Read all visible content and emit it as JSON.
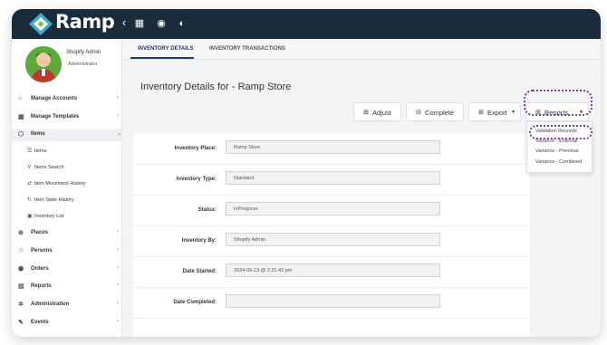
{
  "app": {
    "logo_text": "Ramp"
  },
  "topbar": {
    "icons": [
      "collapse-arrow-icon",
      "grid-icon",
      "globe-icon",
      "dashboard-gauge-icon"
    ],
    "collapse_glyph": "‹",
    "grid_glyph": "▦",
    "globe_glyph": "◉",
    "gauge_glyph": "◐"
  },
  "user": {
    "name": "Shopify Admin",
    "role": "Administrator"
  },
  "sidebar": {
    "items": [
      {
        "label": "Manage Accounts",
        "icon": "building-icon",
        "glyph": "⌂"
      },
      {
        "label": "Manage Templates",
        "icon": "grid-icon",
        "glyph": "▦"
      },
      {
        "label": "Items",
        "icon": "tag-icon",
        "glyph": "⬡"
      },
      {
        "label": "Places",
        "icon": "location-icon",
        "glyph": "⊕"
      },
      {
        "label": "Persons",
        "icon": "person-icon",
        "glyph": "☺"
      },
      {
        "label": "Orders",
        "icon": "box-icon",
        "glyph": "⬢"
      },
      {
        "label": "Reports",
        "icon": "report-icon",
        "glyph": "▤"
      },
      {
        "label": "Administration",
        "icon": "gear-icon",
        "glyph": "✲"
      },
      {
        "label": "Events",
        "icon": "events-icon",
        "glyph": "✎"
      }
    ],
    "sub_items": [
      {
        "label": "Items",
        "glyph": "☰"
      },
      {
        "label": "Items Search",
        "glyph": "⚲"
      },
      {
        "label": "Item Movement History",
        "glyph": "⇄"
      },
      {
        "label": "Item State History",
        "glyph": "↻"
      },
      {
        "label": "Inventory List",
        "glyph": "▣"
      }
    ],
    "chevron": "›",
    "chevron_open": "⌄"
  },
  "tabs": [
    {
      "label": "INVENTORY DETAILS"
    },
    {
      "label": "INVENTORY TRANSACTIONS"
    }
  ],
  "page": {
    "title": "Inventory Details for - Ramp Store"
  },
  "toolbar": {
    "adjust_label": "Adjust",
    "complete_label": "Complete",
    "export_label": "Export",
    "reports_label": "Reports",
    "dropdown_caret": "▼"
  },
  "form": {
    "rows": [
      {
        "label": "Inventory Place:",
        "value": "Ramp Store"
      },
      {
        "label": "Inventory Type:",
        "value": "Standard"
      },
      {
        "label": "Status:",
        "value": "InProgress"
      },
      {
        "label": "Inventory By:",
        "value": "Shopify Admin"
      },
      {
        "label": "Date Started:",
        "value": "2024-09-13 @ 2:21:43 pm"
      },
      {
        "label": "Date Completed:",
        "value": ""
      }
    ]
  },
  "reports_menu": {
    "options": [
      "Validation Records",
      "Variance - External",
      "Variance - Previous",
      "Variance - Combined"
    ]
  },
  "colors": {
    "topbar": "#1a2b3c",
    "highlight": "#7d3c98",
    "tab_active": "#1f3b6b"
  }
}
